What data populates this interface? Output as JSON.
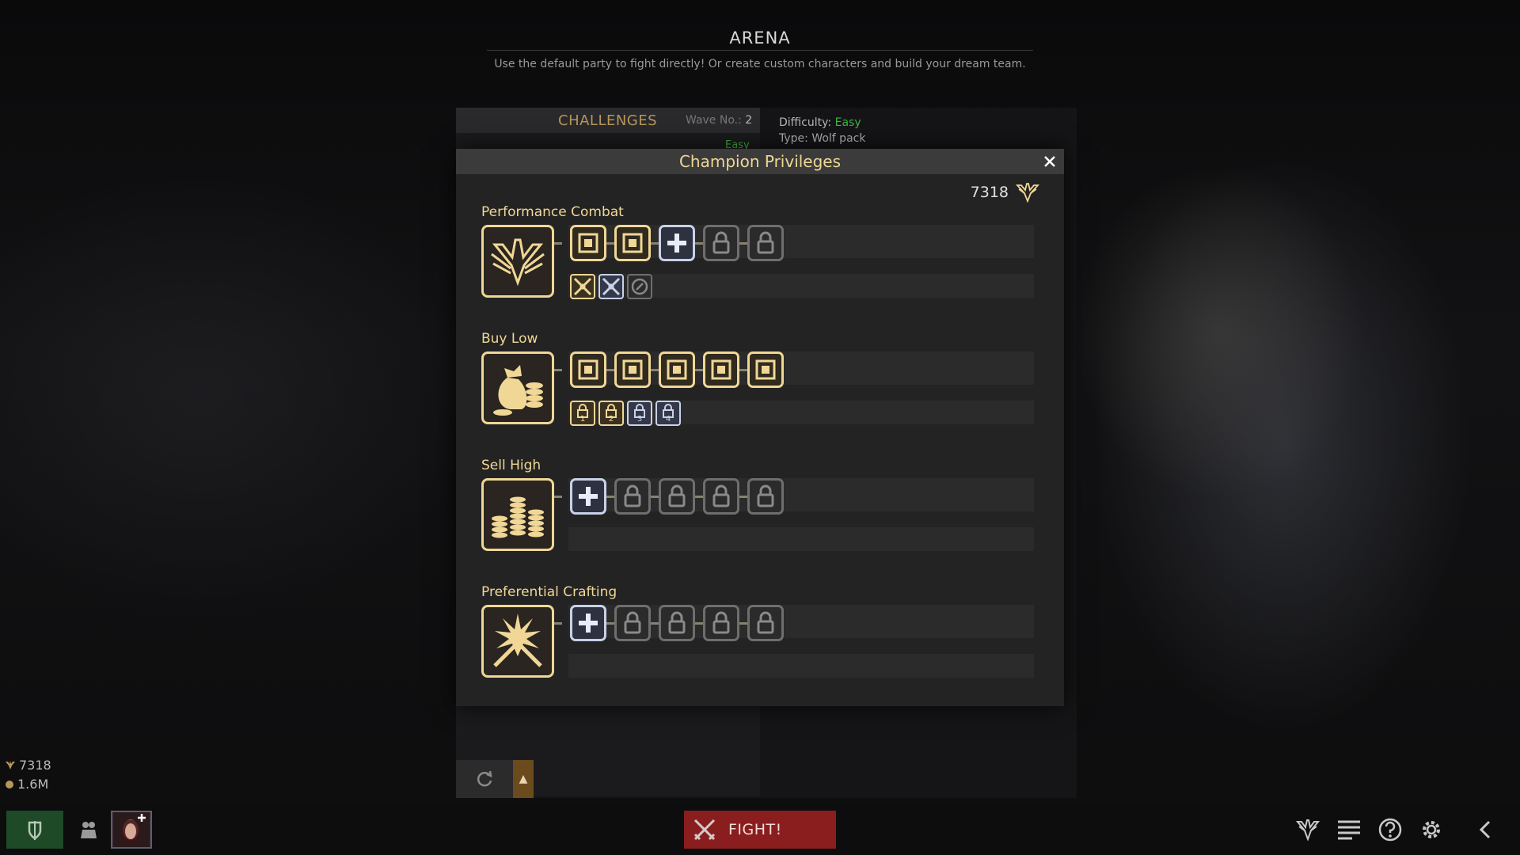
{
  "header": {
    "title": "ARENA",
    "subtitle": "Use the default party to fight directly! Or create custom characters and build your dream team."
  },
  "challenges": {
    "title": "CHALLENGES",
    "wave_label": "Wave No.:",
    "wave_value": "2",
    "first_entry_difficulty": "Easy"
  },
  "details": {
    "difficulty_label": "Difficulty:",
    "difficulty_value": "Easy",
    "type_label": "Type:",
    "type_value": "Wolf pack"
  },
  "modal": {
    "title": "Champion Privileges",
    "points": "7318",
    "points_icon": "champion-wings-icon",
    "sections": [
      {
        "name": "Performance Combat",
        "icon": "winged-emblem-icon",
        "nodes": [
          "unlocked-gold",
          "unlocked-gold",
          "available-plus",
          "locked",
          "locked"
        ],
        "bonuses": [
          {
            "state": "gold",
            "icon": "crossed-swords-icon"
          },
          {
            "state": "silver",
            "icon": "crossed-swords-icon"
          },
          {
            "state": "grey",
            "icon": "cycle-icon"
          }
        ]
      },
      {
        "name": "Buy Low",
        "icon": "coin-bag-icon",
        "nodes": [
          "unlocked-gold",
          "unlocked-gold",
          "unlocked-gold",
          "unlocked-gold",
          "unlocked-gold"
        ],
        "bonuses": [
          {
            "state": "gold",
            "label": "1"
          },
          {
            "state": "gold",
            "label": "2"
          },
          {
            "state": "silver",
            "label": "3"
          },
          {
            "state": "silver",
            "label": "4"
          }
        ]
      },
      {
        "name": "Sell High",
        "icon": "coin-stacks-icon",
        "nodes": [
          "available-plus",
          "locked",
          "locked",
          "locked",
          "locked"
        ],
        "bonuses": []
      },
      {
        "name": "Preferential Crafting",
        "icon": "crafting-star-icon",
        "nodes": [
          "available-plus",
          "locked",
          "locked",
          "locked",
          "locked"
        ],
        "bonuses": []
      }
    ]
  },
  "resources": {
    "champion_points": "7318",
    "gold": "1.6M"
  },
  "bottom": {
    "fight_label": "FIGHT!"
  },
  "colors": {
    "gold_accent": "#f0d796",
    "silver_accent": "#c8d2e8",
    "easy_green": "#3fb63f",
    "fight_red": "#8a1e1e"
  }
}
